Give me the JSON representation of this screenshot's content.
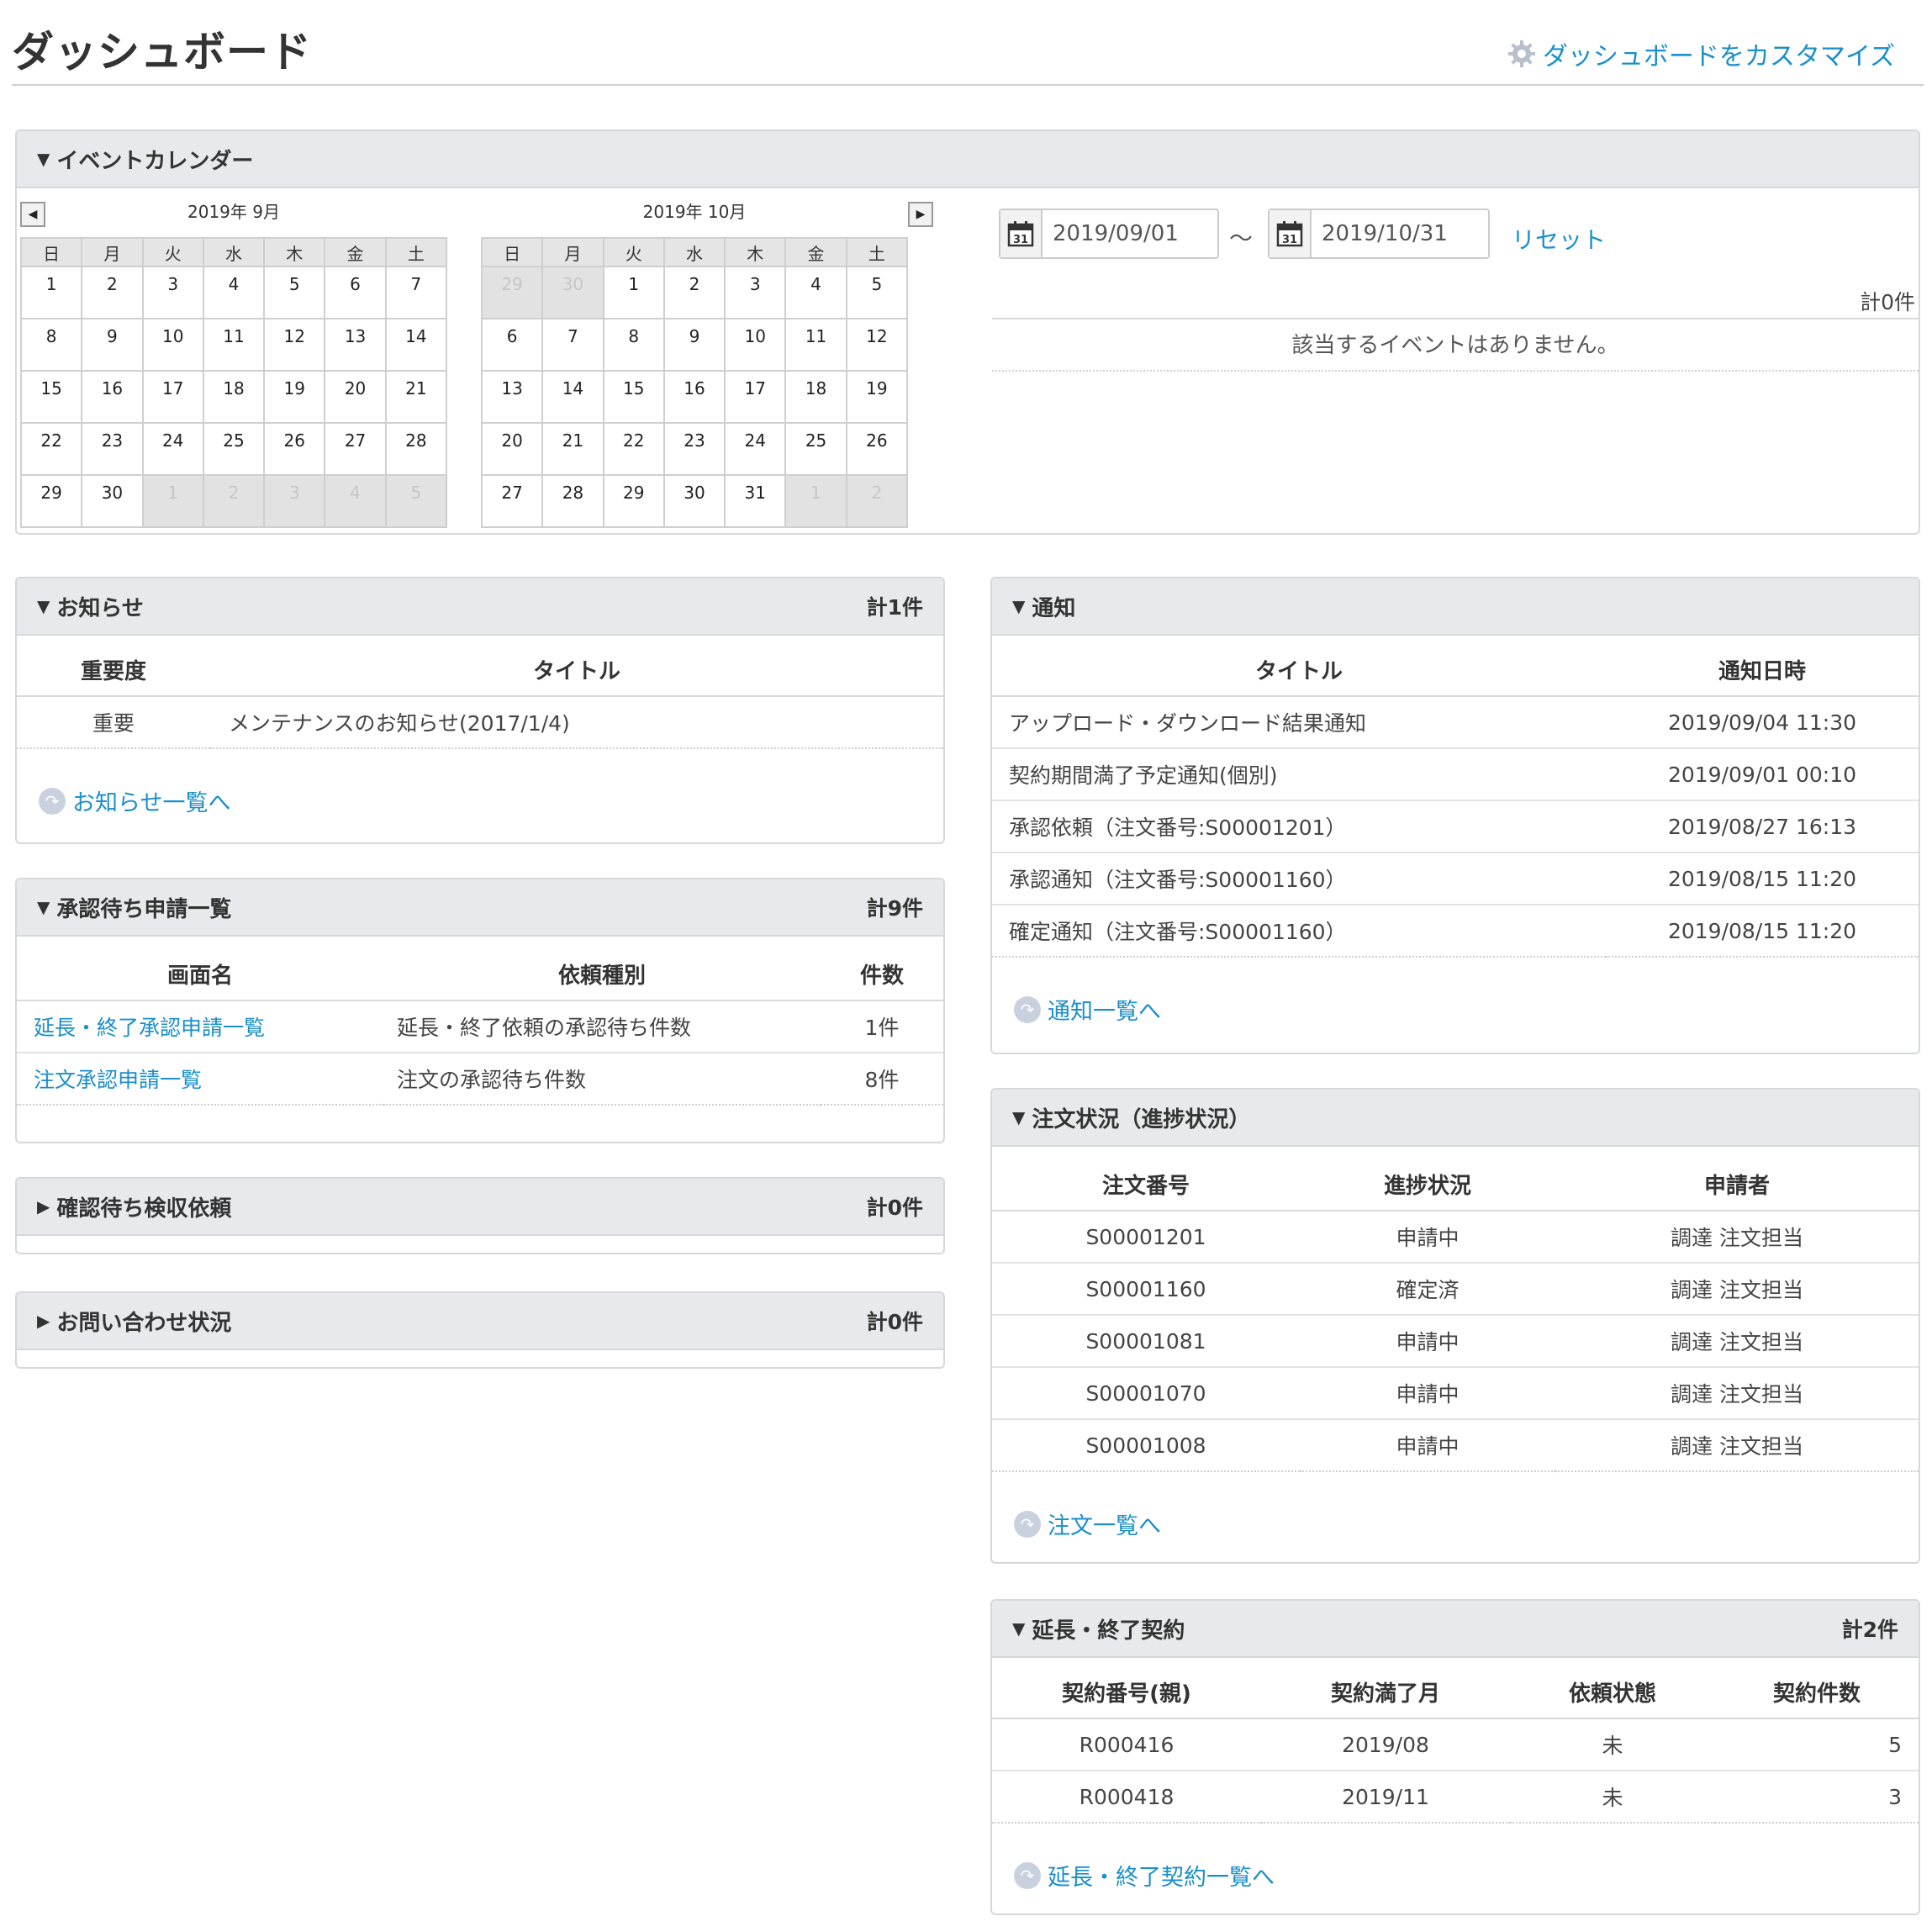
{
  "header": {
    "title": "ダッシュボード",
    "customize_label": "ダッシュボードをカスタマイズ"
  },
  "calendar_panel": {
    "title": "イベントカレンダー",
    "months": [
      {
        "label": "2019年 9月",
        "weekdays": [
          "日",
          "月",
          "火",
          "水",
          "木",
          "金",
          "土"
        ],
        "weeks": [
          [
            {
              "d": "1",
              "out": false
            },
            {
              "d": "2",
              "out": false
            },
            {
              "d": "3",
              "out": false
            },
            {
              "d": "4",
              "out": false
            },
            {
              "d": "5",
              "out": false
            },
            {
              "d": "6",
              "out": false
            },
            {
              "d": "7",
              "out": false
            }
          ],
          [
            {
              "d": "8",
              "out": false
            },
            {
              "d": "9",
              "out": false
            },
            {
              "d": "10",
              "out": false
            },
            {
              "d": "11",
              "out": false
            },
            {
              "d": "12",
              "out": false
            },
            {
              "d": "13",
              "out": false
            },
            {
              "d": "14",
              "out": false
            }
          ],
          [
            {
              "d": "15",
              "out": false
            },
            {
              "d": "16",
              "out": false
            },
            {
              "d": "17",
              "out": false
            },
            {
              "d": "18",
              "out": false
            },
            {
              "d": "19",
              "out": false
            },
            {
              "d": "20",
              "out": false
            },
            {
              "d": "21",
              "out": false
            }
          ],
          [
            {
              "d": "22",
              "out": false
            },
            {
              "d": "23",
              "out": false
            },
            {
              "d": "24",
              "out": false
            },
            {
              "d": "25",
              "out": false
            },
            {
              "d": "26",
              "out": false
            },
            {
              "d": "27",
              "out": false
            },
            {
              "d": "28",
              "out": false
            }
          ],
          [
            {
              "d": "29",
              "out": false
            },
            {
              "d": "30",
              "out": false
            },
            {
              "d": "1",
              "out": true
            },
            {
              "d": "2",
              "out": true
            },
            {
              "d": "3",
              "out": true
            },
            {
              "d": "4",
              "out": true
            },
            {
              "d": "5",
              "out": true
            }
          ]
        ]
      },
      {
        "label": "2019年 10月",
        "weekdays": [
          "日",
          "月",
          "火",
          "水",
          "木",
          "金",
          "土"
        ],
        "weeks": [
          [
            {
              "d": "29",
              "out": true
            },
            {
              "d": "30",
              "out": true
            },
            {
              "d": "1",
              "out": false
            },
            {
              "d": "2",
              "out": false
            },
            {
              "d": "3",
              "out": false
            },
            {
              "d": "4",
              "out": false
            },
            {
              "d": "5",
              "out": false
            }
          ],
          [
            {
              "d": "6",
              "out": false
            },
            {
              "d": "7",
              "out": false
            },
            {
              "d": "8",
              "out": false
            },
            {
              "d": "9",
              "out": false
            },
            {
              "d": "10",
              "out": false
            },
            {
              "d": "11",
              "out": false
            },
            {
              "d": "12",
              "out": false
            }
          ],
          [
            {
              "d": "13",
              "out": false
            },
            {
              "d": "14",
              "out": false
            },
            {
              "d": "15",
              "out": false
            },
            {
              "d": "16",
              "out": false
            },
            {
              "d": "17",
              "out": false
            },
            {
              "d": "18",
              "out": false
            },
            {
              "d": "19",
              "out": false
            }
          ],
          [
            {
              "d": "20",
              "out": false
            },
            {
              "d": "21",
              "out": false
            },
            {
              "d": "22",
              "out": false
            },
            {
              "d": "23",
              "out": false
            },
            {
              "d": "24",
              "out": false
            },
            {
              "d": "25",
              "out": false
            },
            {
              "d": "26",
              "out": false
            }
          ],
          [
            {
              "d": "27",
              "out": false
            },
            {
              "d": "28",
              "out": false
            },
            {
              "d": "29",
              "out": false
            },
            {
              "d": "30",
              "out": false
            },
            {
              "d": "31",
              "out": false
            },
            {
              "d": "1",
              "out": true
            },
            {
              "d": "2",
              "out": true
            }
          ]
        ]
      }
    ],
    "date_from": "2019/09/01",
    "date_to": "2019/10/31",
    "tilde": "～",
    "reset_label": "リセット",
    "calendar_icon_text": "31",
    "count": "計0件",
    "empty_message": "該当するイベントはありません。"
  },
  "notice_panel": {
    "title": "お知らせ",
    "count": "計1件",
    "columns": [
      "重要度",
      "タイトル"
    ],
    "rows": [
      [
        "重要",
        "メンテナンスのお知らせ(2017/1/4)"
      ]
    ],
    "more_link": "お知らせ一覧へ"
  },
  "approval_panel": {
    "title": "承認待ち申請一覧",
    "count": "計9件",
    "columns": [
      "画面名",
      "依頼種別",
      "件数"
    ],
    "rows": [
      [
        "延長・終了承認申請一覧",
        "延長・終了依頼の承認待ち件数",
        "1件"
      ],
      [
        "注文承認申請一覧",
        "注文の承認待ち件数",
        "8件"
      ]
    ]
  },
  "inspection_panel": {
    "title": "確認待ち検収依頼",
    "count": "計0件"
  },
  "inquiry_panel": {
    "title": "お問い合わせ状況",
    "count": "計0件"
  },
  "notification_panel": {
    "title": "通知",
    "columns": [
      "タイトル",
      "通知日時"
    ],
    "rows": [
      [
        "アップロード・ダウンロード結果通知",
        "2019/09/04 11:30"
      ],
      [
        "契約期間満了予定通知(個別)",
        "2019/09/01 00:10"
      ],
      [
        "承認依頼（注文番号:S00001201）",
        "2019/08/27 16:13"
      ],
      [
        "承認通知（注文番号:S00001160）",
        "2019/08/15 11:20"
      ],
      [
        "確定通知（注文番号:S00001160）",
        "2019/08/15 11:20"
      ]
    ],
    "more_link": "通知一覧へ"
  },
  "order_panel": {
    "title": "注文状況（進捗状況）",
    "columns": [
      "注文番号",
      "進捗状況",
      "申請者"
    ],
    "rows": [
      [
        "S00001201",
        "申請中",
        "調達 注文担当"
      ],
      [
        "S00001160",
        "確定済",
        "調達 注文担当"
      ],
      [
        "S00001081",
        "申請中",
        "調達 注文担当"
      ],
      [
        "S00001070",
        "申請中",
        "調達 注文担当"
      ],
      [
        "S00001008",
        "申請中",
        "調達 注文担当"
      ]
    ],
    "more_link": "注文一覧へ"
  },
  "contract_panel": {
    "title": "延長・終了契約",
    "count": "計2件",
    "columns": [
      "契約番号(親)",
      "契約満了月",
      "依頼状態",
      "契約件数"
    ],
    "rows": [
      [
        "R000416",
        "2019/08",
        "未",
        "5"
      ],
      [
        "R000418",
        "2019/11",
        "未",
        "3"
      ]
    ],
    "more_link": "延長・終了契約一覧へ"
  },
  "icons": {
    "expanded": "triangle-down-icon",
    "collapsed": "triangle-right-icon",
    "more": "circle-arrow-icon",
    "gear": "gear-icon",
    "calendar": "calendar-icon"
  },
  "colors": {
    "link": "#1a8fc9",
    "panel_header": "#e8e9ec",
    "out_of_month": "#e2e2e2"
  }
}
